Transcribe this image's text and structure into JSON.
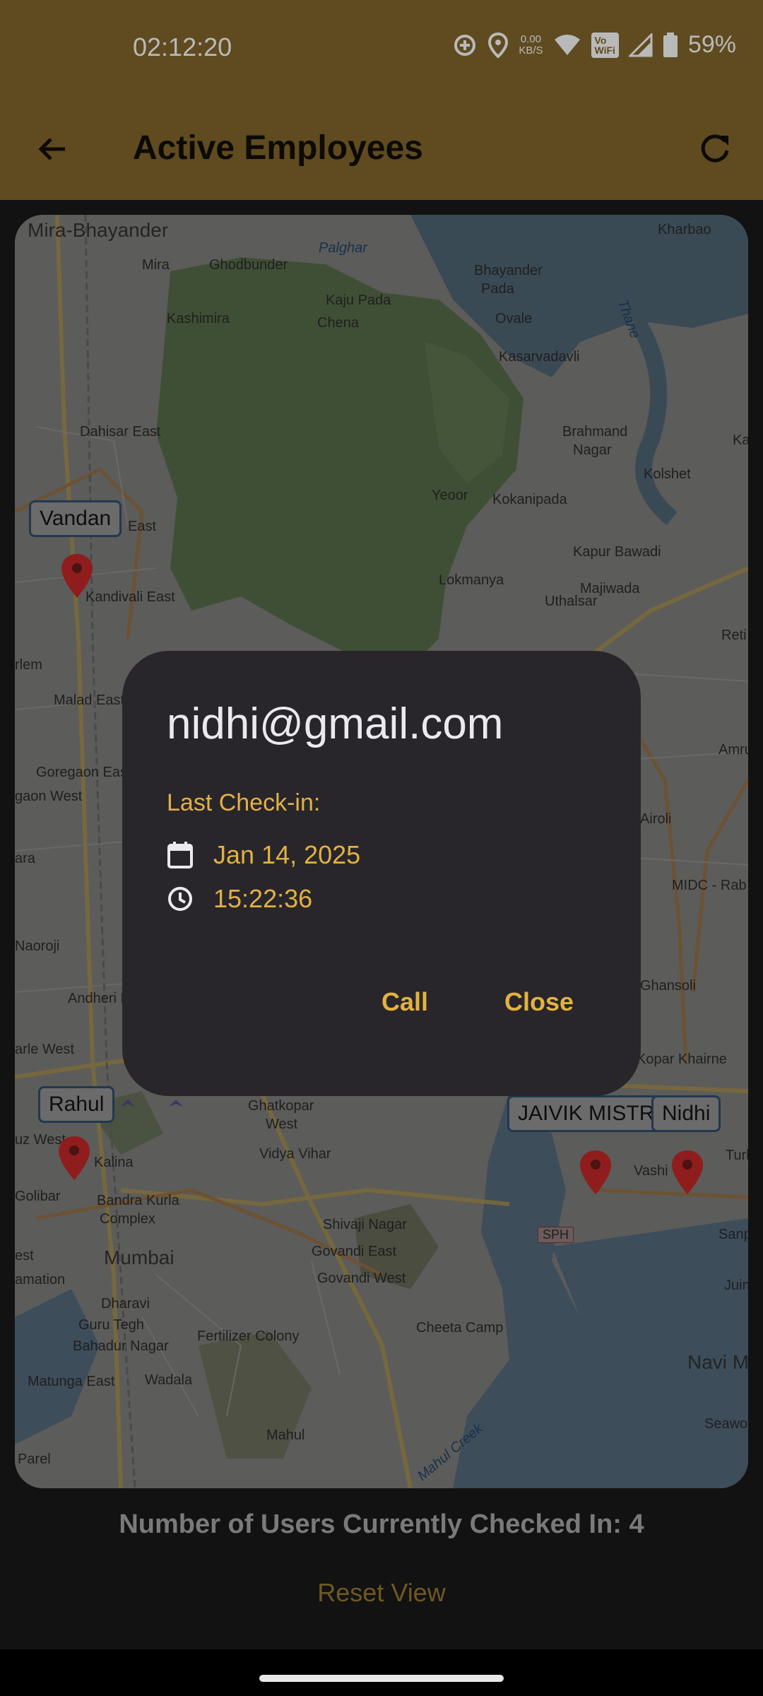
{
  "status_bar": {
    "time": "02:12:20",
    "net_speed_value": "0.00",
    "net_speed_unit": "KB/S",
    "volte_line1": "Vo",
    "volte_line2": "WiFi",
    "battery": "59%"
  },
  "app_bar": {
    "title": "Active Employees"
  },
  "map": {
    "places": [
      "Mira-Bhayander",
      "Mira",
      "Ghodbunder",
      "Palghar",
      "Bhayander",
      "Pada",
      "Kharbao",
      "Kaju Pada",
      "Chena",
      "Kashimira",
      "Ovale",
      "Kasarvadavli",
      "Dahisar East",
      "Brahmand",
      "Nagar",
      "Kolshet",
      "Yeoor",
      "Kokanipada",
      "East",
      "Kapur Bawadi",
      "Kandivali East",
      "Lokmanya",
      "Majiwada",
      "Uthalsar",
      "Reti B",
      "rlem",
      "Malad East",
      "Goregaon East",
      "gaon West",
      "Amru",
      "Airoli",
      "ara",
      "MIDC - Rab",
      "Naoroji",
      "Andheri East",
      "Ghansoli",
      "arle West",
      "Kopar Khairne",
      "Ghatkopar",
      "West",
      "Vidya Vihar",
      "Kalina",
      "Golibar",
      "Bandra Kurla",
      "Complex",
      "Vashi",
      "Turbhe",
      "Sanpada",
      "Shivaji Nagar",
      "Govandi East",
      "Mumbai",
      "Govandi West",
      "Dharavi",
      "Guru Tegh",
      "Bahadur Nagar",
      "Fertilizer Colony",
      "Cheeta Camp",
      "Matunga East",
      "Wadala",
      "Navi M",
      "Mahul",
      "Parel",
      "Seawoo",
      "SPH",
      "Juinag",
      "Kalhe",
      "Thane",
      "Mahul Creek",
      "uz West",
      "est",
      "amation"
    ],
    "markers": [
      {
        "label": "Vandan"
      },
      {
        "label": "Rahul"
      },
      {
        "label": "JAIVIK MISTRY"
      },
      {
        "label": "Nidhi"
      }
    ]
  },
  "dialog": {
    "email": "nidhi@gmail.com",
    "last_checkin_label": "Last Check-in:",
    "date": "Jan 14, 2025",
    "time": "15:22:36",
    "call_label": "Call",
    "close_label": "Close"
  },
  "footer": {
    "count_text": "Number of Users Currently Checked In: 4",
    "reset_label": "Reset View"
  },
  "colors": {
    "appbar_dimmed": "#5f4b1f",
    "accent": "#e2b143",
    "dialog_bg": "#28262b",
    "marker_red": "#8f1d1d"
  }
}
